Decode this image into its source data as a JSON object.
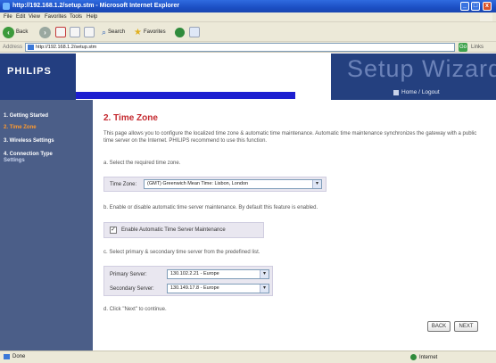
{
  "window": {
    "title": "http://192.168.1.2/setup.stm - Microsoft Internet Explorer",
    "min": "_",
    "max": "□",
    "close": "x"
  },
  "menu": [
    "File",
    "Edit",
    "View",
    "Favorites",
    "Tools",
    "Help"
  ],
  "toolbar": {
    "back": "Back",
    "search": "Search",
    "favorites": "Favorites"
  },
  "address": {
    "label": "Address",
    "url": "http://192.168.1.2/setup.stm",
    "go": "Go",
    "links": "Links"
  },
  "header": {
    "logo": "PHILIPS",
    "setup_title": "Setup Wizard",
    "home_link": "Home / Logout"
  },
  "sidebar": [
    {
      "label": "1. Getting Started"
    },
    {
      "label": "2. Time Zone"
    },
    {
      "label": "3. Wireless Settings"
    },
    {
      "label": "4. Connection Type"
    },
    {
      "label": "Settings"
    }
  ],
  "content": {
    "title": "2. Time Zone",
    "intro": "This page allows you to configure the localized time zone & automatic time maintenance. Automatic time maintenance synchronizes the gateway with a public time server on the Internet. PHILIPS recommend to use this function.",
    "step_a": "a. Select the required time zone.",
    "time_zone_label": "Time Zone:",
    "time_zone_value": "(GMT) Greenwich Mean Time: Lisbon, London",
    "step_b": "b. Enable or disable automatic time server maintenance. By default this feature is enabled.",
    "enable_label": "Enable Automatic Time Server Maintenance",
    "enable_checked": "✓",
    "step_c": "c. Select primary & secondary time server from the predefined list.",
    "primary_label": "Primary Server:",
    "primary_value": "130.102.2.21 - Europe",
    "secondary_label": "Secondary Server:",
    "secondary_value": "130.149.17.8 - Europe",
    "step_d": "d. Click \"Next\" to continue.",
    "back_button": "BACK",
    "next_button": "NEXT"
  },
  "status": {
    "left": "Done",
    "zone": "Internet"
  }
}
